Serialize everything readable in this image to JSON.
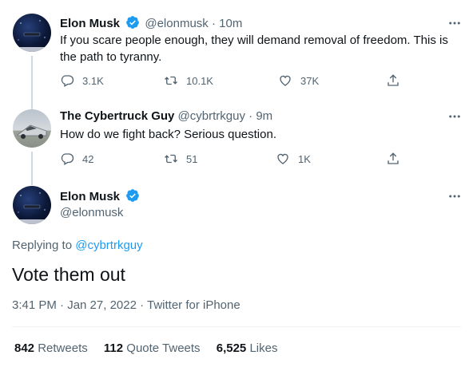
{
  "tweets": [
    {
      "name": "Elon Musk",
      "handle": "@elonmusk",
      "time": "10m",
      "text": "If you scare people enough, they will demand removal of freedom. This is the path to tyranny.",
      "replies": "3.1K",
      "retweets": "10.1K",
      "likes": "37K"
    },
    {
      "name": "The Cybertruck Guy",
      "handle": "@cybrtrkguy",
      "time": "9m",
      "text": "How do we fight back? Serious question.",
      "replies": "42",
      "retweets": "51",
      "likes": "1K"
    }
  ],
  "main": {
    "name": "Elon Musk",
    "handle": "@elonmusk",
    "replying_prefix": "Replying to",
    "replying_mention": "@cybrtrkguy",
    "text": "Vote them out",
    "timestamp": "3:41 PM · Jan 27, 2022 · Twitter for iPhone",
    "retweets_count": "842",
    "retweets_label": "Retweets",
    "quotes_count": "112",
    "quotes_label": "Quote Tweets",
    "likes_count": "6,525",
    "likes_label": "Likes"
  },
  "separator": "·",
  "colors": {
    "verified": "#1d9bf0",
    "link": "#1d9bf0",
    "muted": "#536471",
    "text": "#0f1419"
  },
  "icons": [
    "reply-icon",
    "retweet-icon",
    "like-icon",
    "share-icon",
    "more-icon",
    "verified-badge-icon"
  ]
}
